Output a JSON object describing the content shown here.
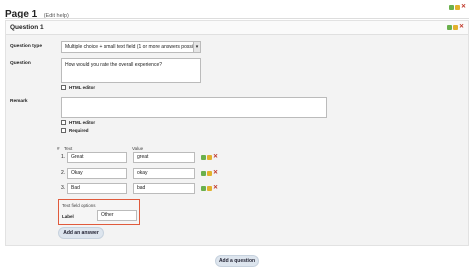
{
  "page": {
    "title": "Page 1",
    "edit_help": "(Edit help)"
  },
  "question": {
    "title": "Question 1",
    "labels": {
      "question_type": "Question type",
      "question": "Question",
      "remark": "Remark"
    },
    "question_type_value": "Multiple choice + small text field (1 or more answers possi",
    "question_text": "How would you rate the overall experience?",
    "remark_text": "",
    "checkboxes": {
      "html_editor_question": "HTML editor",
      "html_editor_remark": "HTML editor",
      "required": "Required"
    },
    "options_header": {
      "number": "#",
      "text": "Text",
      "value": "Value"
    },
    "options": [
      {
        "num": "1.",
        "text": "Great",
        "value": "great"
      },
      {
        "num": "2.",
        "text": "Okay",
        "value": "okay"
      },
      {
        "num": "3.",
        "text": "Bad",
        "value": "bad"
      }
    ],
    "text_field_options": {
      "title": "Text field options",
      "label": "Label",
      "value": "Other"
    },
    "add_answer": "Add an answer"
  },
  "add_question": "Add a question",
  "icons": [
    "add-icon",
    "edit-icon",
    "delete-icon"
  ]
}
